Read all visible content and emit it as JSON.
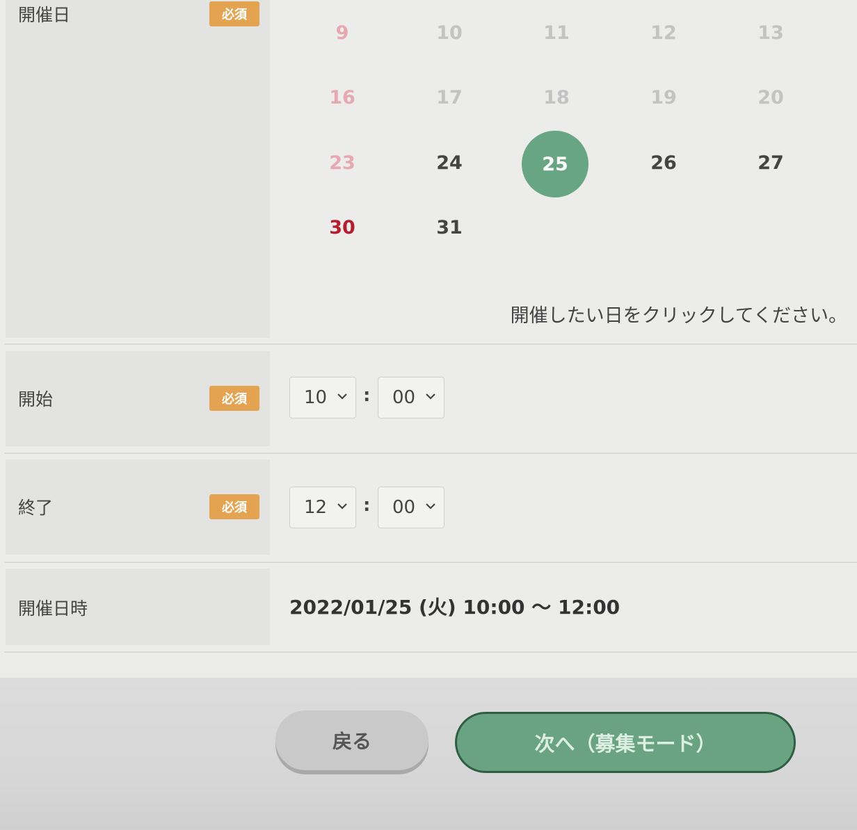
{
  "rows": {
    "date": {
      "label": "開催日",
      "badge": "必須"
    },
    "start": {
      "label": "開始",
      "badge": "必須",
      "hour": "10",
      "minute": "00"
    },
    "end": {
      "label": "終了",
      "badge": "必須",
      "hour": "12",
      "minute": "00"
    },
    "datetime": {
      "label": "開催日時",
      "value": "2022/01/25 (火) 10:00 ～ 12:00"
    }
  },
  "calendar": {
    "days": [
      "9",
      "10",
      "11",
      "12",
      "13",
      "16",
      "17",
      "18",
      "19",
      "20",
      "23",
      "24",
      "25",
      "26",
      "27",
      "30",
      "31"
    ],
    "selected": "25",
    "hint": "開催したい日をクリックしてください。"
  },
  "time_separator": ":",
  "buttons": {
    "back": "戻る",
    "next": "次へ（募集モード）"
  },
  "colors": {
    "accent_green": "#67a583",
    "badge_orange": "#e4a350",
    "sunday_red": "#b41e30"
  }
}
